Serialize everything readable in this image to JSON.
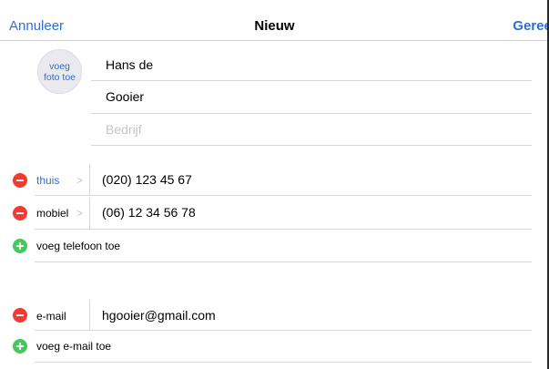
{
  "navbar": {
    "cancel": "Annuleer",
    "title": "Nieuw",
    "done": "Gereed"
  },
  "photo": {
    "label": "voeg foto toe"
  },
  "name": {
    "first": "Hans de",
    "last": "Gooier",
    "company_placeholder": "Bedrijf"
  },
  "phones": [
    {
      "label": "thuis",
      "value": "(020) 123 45 67"
    },
    {
      "label": "mobiel",
      "value": "(06) 12 34 56 78"
    }
  ],
  "add_phone": "voeg telefoon toe",
  "emails": [
    {
      "label": "e-mail",
      "value": "hgooier@gmail.com"
    }
  ],
  "add_email": "voeg e-mail toe",
  "colors": {
    "accent": "#2f6fd6",
    "delete": "#f23a30",
    "add": "#45c95a"
  }
}
